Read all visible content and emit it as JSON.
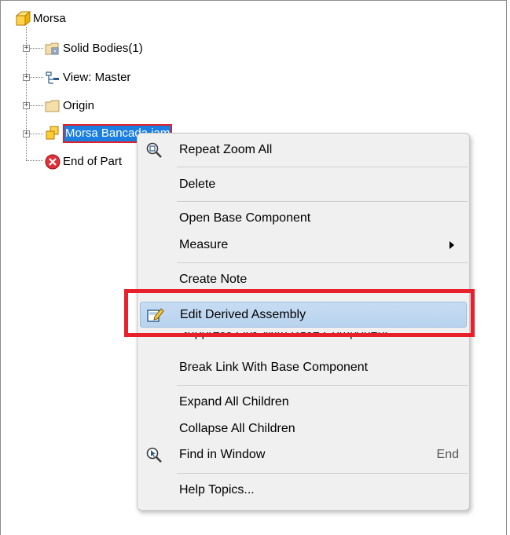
{
  "tree": {
    "root_label": "Morsa",
    "items": [
      {
        "label": "Solid Bodies(1)"
      },
      {
        "label": "View: Master"
      },
      {
        "label": "Origin"
      },
      {
        "label": "Morsa Bancada.iam"
      },
      {
        "label": "End of Part"
      }
    ]
  },
  "context_menu": {
    "items": [
      {
        "label": "Repeat Zoom All"
      },
      {
        "label": "Delete"
      },
      {
        "label": "Open Base Component"
      },
      {
        "label": "Measure"
      },
      {
        "label": "Create Note"
      },
      {
        "label": "Edit Derived Assembly"
      },
      {
        "label": "Suppress Link With Base Component"
      },
      {
        "label": "Break Link With Base Component"
      },
      {
        "label": "Expand All Children"
      },
      {
        "label": "Collapse All Children"
      },
      {
        "label": "Find in Window",
        "shortcut": "End"
      },
      {
        "label": "Help Topics..."
      }
    ]
  },
  "colors": {
    "selection": "#1a7fe0",
    "annotation_red": "#e8202b",
    "menu_bg": "#f0f0f0",
    "menu_highlight": "#c6dcf3"
  }
}
